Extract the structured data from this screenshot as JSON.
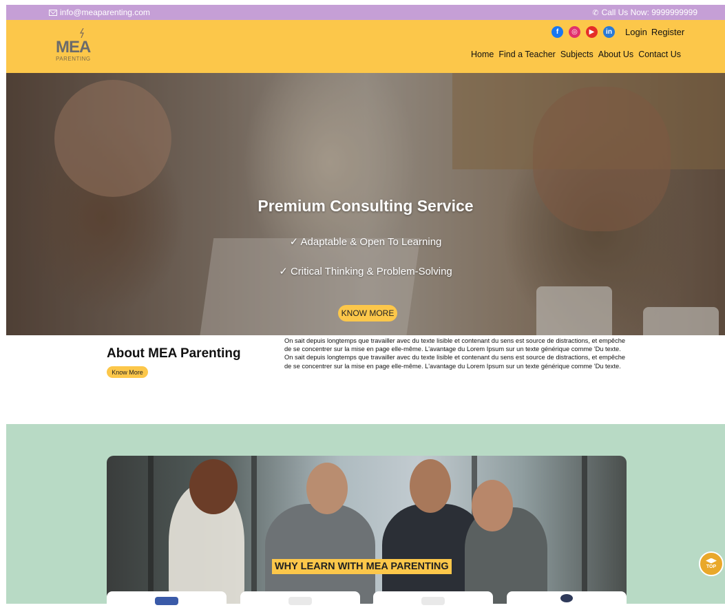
{
  "topbar": {
    "email": "info@meaparenting.com",
    "phone": "Call Us Now: 9999999999"
  },
  "header": {
    "logo_main": "MEA",
    "logo_sub": "PARENTING",
    "social": {
      "facebook": "f",
      "instagram": "◎",
      "youtube": "▶",
      "linkedin": "in"
    },
    "login": "Login",
    "register": "Register",
    "nav": [
      "Home",
      "Find a Teacher",
      "Subjects",
      "About Us",
      "Contact Us"
    ]
  },
  "hero": {
    "title": "Premium Consulting Service",
    "points": [
      "✓ Adaptable & Open To Learning",
      "✓ Critical Thinking & Problem-Solving"
    ],
    "button": "KNOW MORE"
  },
  "about": {
    "title": "About MEA Parenting",
    "button": "Know More",
    "paragraph1": "On sait depuis longtemps que travailler avec du texte lisible et contenant du sens est source de distractions, et empêche de se concentrer sur la mise en page elle-même. L'avantage du Lorem Ipsum sur un texte générique comme 'Du texte.",
    "paragraph2": "On sait depuis longtemps que travailler avec du texte lisible et contenant du sens est source de distractions, et empêche de se concentrer sur la mise en page elle-même. L'avantage du Lorem Ipsum sur un texte générique comme 'Du texte."
  },
  "why": {
    "label": "WHY LEARN WITH MEA PARENTING"
  },
  "scroll_top": {
    "label": "TOP"
  },
  "colors": {
    "topbar": "#c59fd6",
    "accent": "#fcc74a",
    "why_bg": "#b8dac5"
  }
}
